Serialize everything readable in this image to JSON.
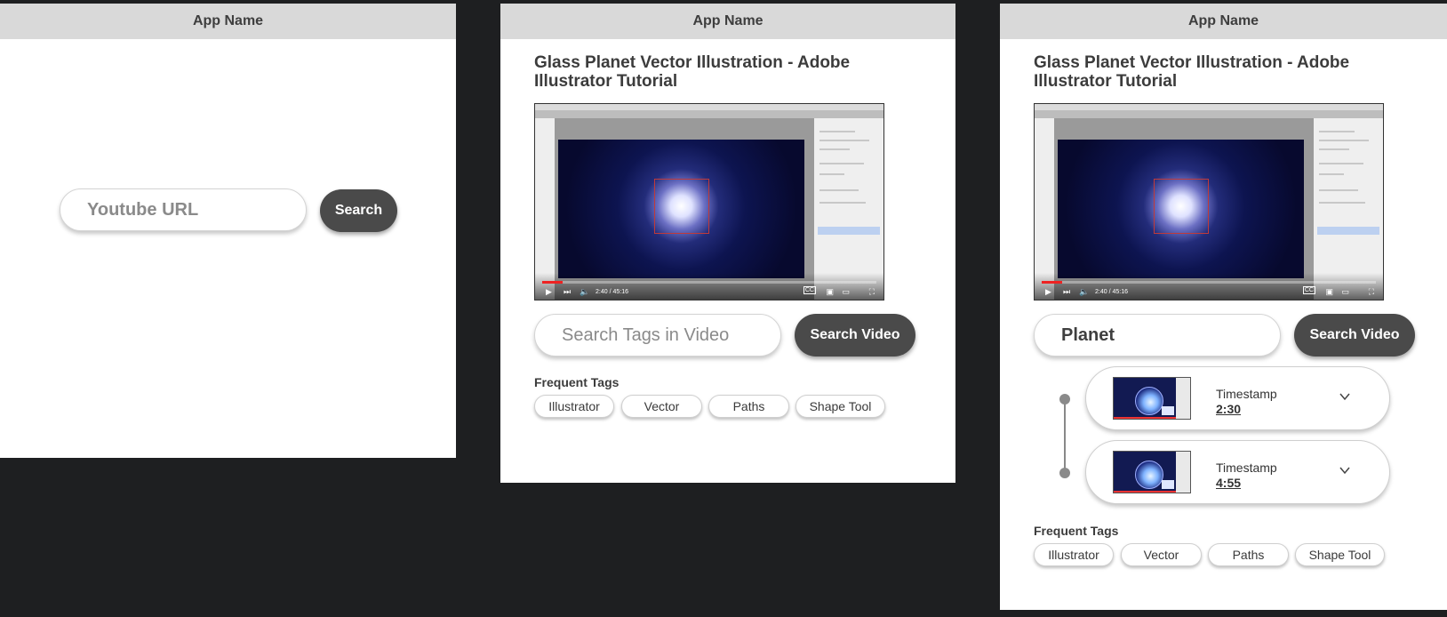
{
  "app": {
    "name": "App Name"
  },
  "screen1": {
    "url_placeholder": "Youtube URL",
    "search_label": "Search"
  },
  "video": {
    "title": "Glass Planet Vector Illustration - Adobe Illustrator Tutorial",
    "current_time": "2:40 / 45:16",
    "progress": 0.06
  },
  "screen2": {
    "tag_search_placeholder": "Search Tags in Video",
    "search_video_label": "Search Video",
    "frequent_tags_label": "Frequent Tags",
    "tags": [
      "Illustrator",
      "Vector",
      "Paths",
      "Shape Tool"
    ]
  },
  "screen3": {
    "tag_search_value": "Planet",
    "search_video_label": "Search Video",
    "results": [
      {
        "label": "Timestamp",
        "time": "2:30"
      },
      {
        "label": "Timestamp",
        "time": "4:55"
      }
    ],
    "frequent_tags_label": "Frequent Tags",
    "tags": [
      "Illustrator",
      "Vector",
      "Paths",
      "Shape Tool"
    ]
  },
  "icons": {
    "play": "play-icon",
    "next": "next-icon",
    "volume": "volume-icon",
    "captions": "captions-icon",
    "miniplayer": "miniplayer-icon",
    "theater": "theater-icon",
    "fullscreen": "fullscreen-icon",
    "chevron": "chevron-down-icon"
  },
  "colors": {
    "background": "#1e1f21",
    "appbar": "#d9d9d9",
    "button": "#4a4a4a",
    "progress": "#e22222"
  }
}
